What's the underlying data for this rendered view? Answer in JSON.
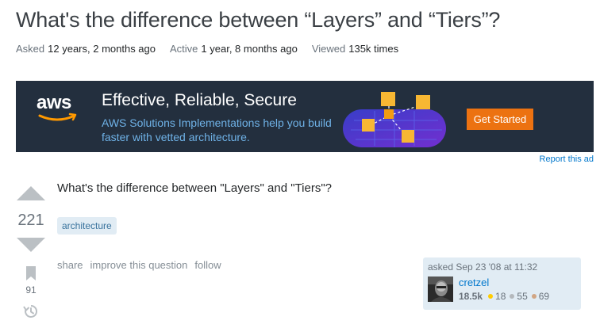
{
  "question": {
    "title": "What's the difference between “Layers” and “Tiers”?",
    "body": "What's the difference between \"Layers\" and \"Tiers\"?",
    "tag": "architecture",
    "votes": "221",
    "favorites": "91"
  },
  "meta": {
    "asked_label": "Asked",
    "asked_value": "12 years, 2 months ago",
    "active_label": "Active",
    "active_value": "1 year, 8 months ago",
    "viewed_label": "Viewed",
    "viewed_value": "135k times"
  },
  "ad": {
    "logo_text": "aws",
    "headline": "Effective, Reliable, Secure",
    "subtext": "AWS Solutions Implementations help you build faster with vetted architecture.",
    "cta": "Get Started",
    "report": "Report this ad",
    "colors": {
      "background": "#232f3e",
      "cta": "#ec7211",
      "subtext": "#6fb2e7"
    }
  },
  "post_menu": {
    "share": "share",
    "improve": "improve this question",
    "follow": "follow"
  },
  "owner": {
    "asked": "asked Sep 23 '08 at 11:32",
    "name": "cretzel",
    "reputation": "18.5k",
    "gold": "18",
    "silver": "55",
    "bronze": "69",
    "colors": {
      "gold": "#ffcc01",
      "silver": "#b4b8bc",
      "bronze": "#d1a684"
    }
  },
  "icons": [
    "vote-up-icon",
    "vote-down-icon",
    "bookmark-icon",
    "history-icon",
    "aws-logo-icon"
  ]
}
